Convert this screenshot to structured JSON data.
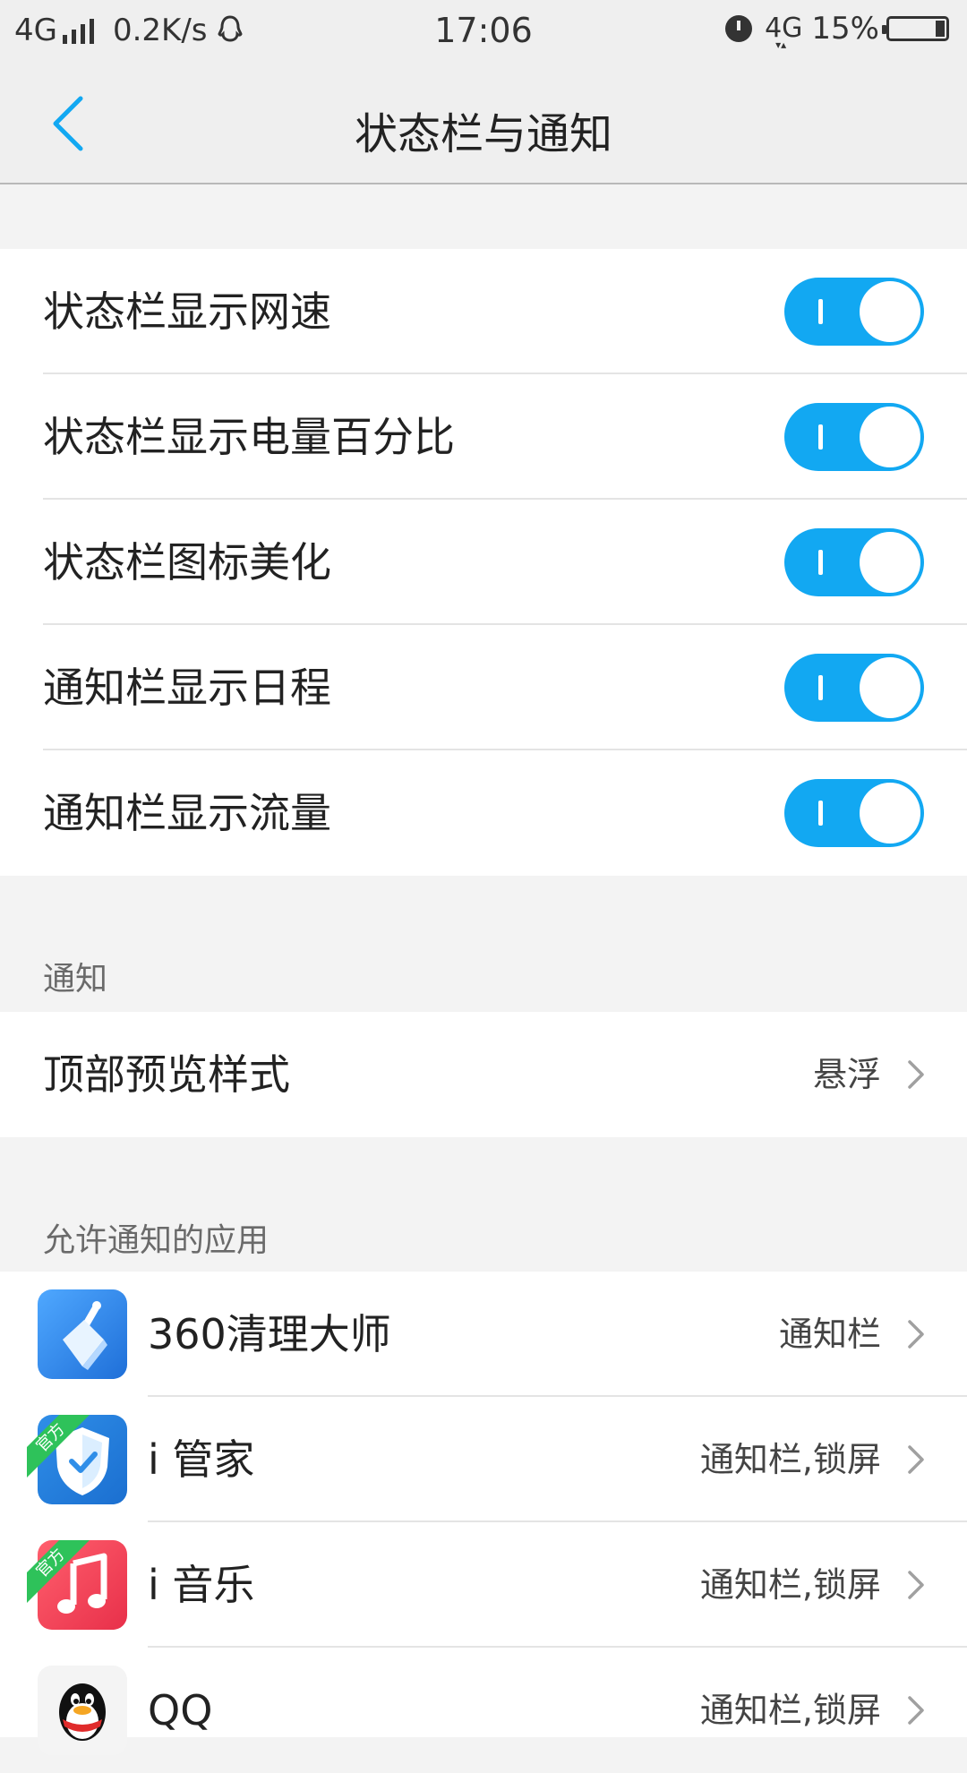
{
  "status_bar": {
    "network": "4G",
    "speed": "0.2K/s",
    "time": "17:06",
    "net_right": "4G",
    "battery": "15%",
    "battery_level": 0.15
  },
  "header": {
    "title": "状态栏与通知"
  },
  "toggles": [
    {
      "label": "状态栏显示网速",
      "on": true
    },
    {
      "label": "状态栏显示电量百分比",
      "on": true
    },
    {
      "label": "状态栏图标美化",
      "on": true
    },
    {
      "label": "通知栏显示日程",
      "on": true
    },
    {
      "label": "通知栏显示流量",
      "on": true
    }
  ],
  "notification_section": {
    "title": "通知",
    "items": [
      {
        "label": "顶部预览样式",
        "value": "悬浮"
      }
    ]
  },
  "apps_section": {
    "title": "允许通知的应用",
    "official_badge": "官方",
    "apps": [
      {
        "name": "360清理大师",
        "value": "通知栏",
        "icon": "broom-icon"
      },
      {
        "name": "i 管家",
        "value": "通知栏,锁屏",
        "icon": "shield-check-icon",
        "official": true
      },
      {
        "name": "i 音乐",
        "value": "通知栏,锁屏",
        "icon": "music-note-icon",
        "official": true
      },
      {
        "name": "QQ",
        "value": "通知栏,锁屏",
        "icon": "qq-penguin-icon"
      }
    ]
  },
  "colors": {
    "accent": "#12a8f2",
    "badge_green": "#2ec25a"
  }
}
